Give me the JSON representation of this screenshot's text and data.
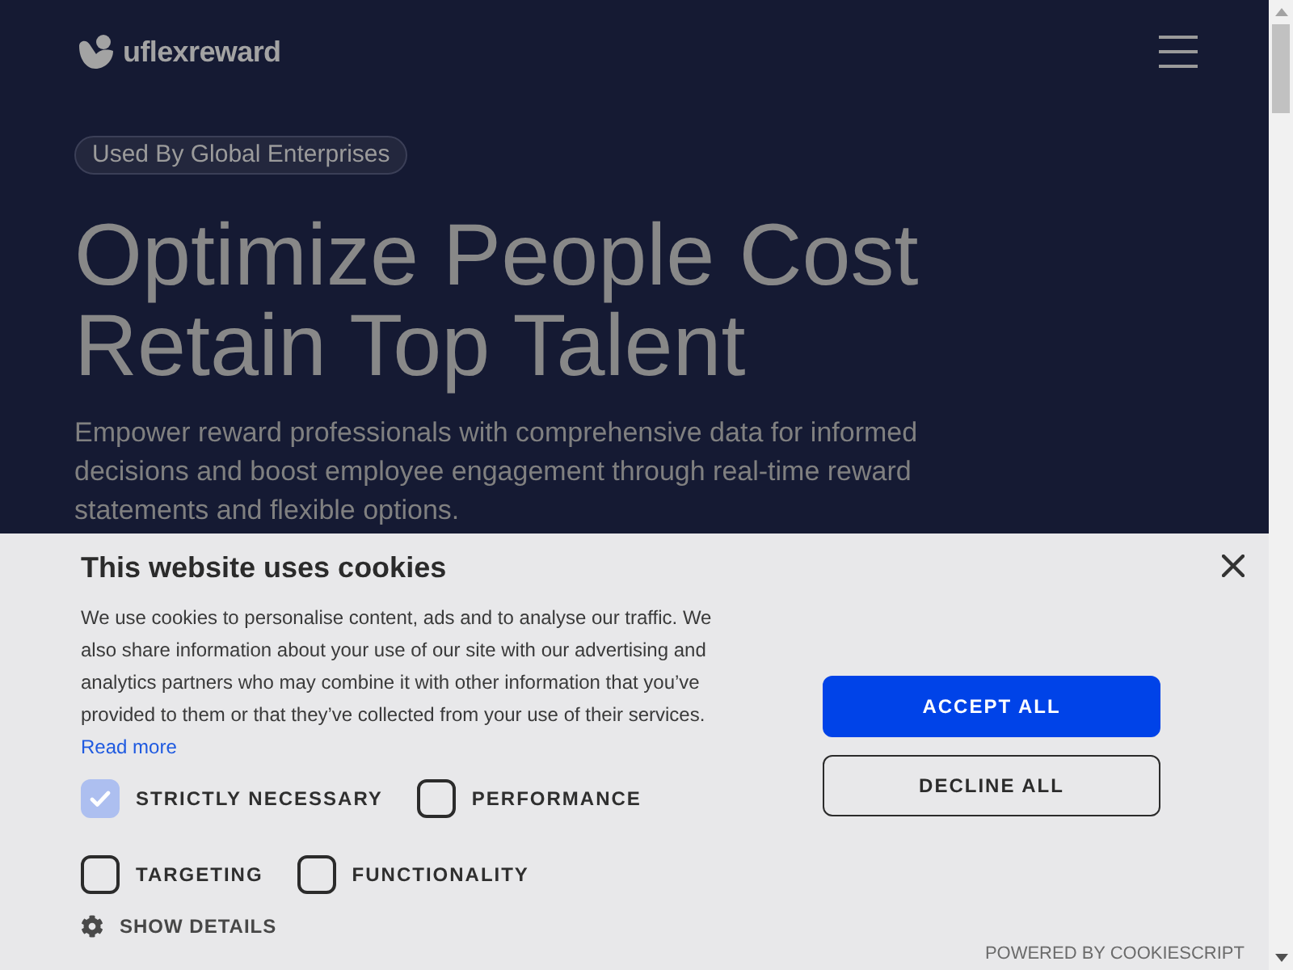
{
  "header": {
    "logo_text": "uflexreward"
  },
  "hero": {
    "badge": "Used By Global Enterprises",
    "title_lines": [
      "Optimize People Cost",
      "Retain Top Talent"
    ],
    "description": "Empower reward professionals with comprehensive data for informed decisions and boost employee engagement through real-time reward statements and flexible options."
  },
  "cookie_banner": {
    "title": "This website uses cookies",
    "description": "We use cookies to personalise content, ads and to analyse our traffic. We also share information about your use of our site with our advertising and analytics partners who may combine it with other information that you’ve provided to them or that they’ve collected from your use of their services.",
    "read_more": "Read more",
    "categories": [
      {
        "label": "STRICTLY NECESSARY",
        "checked": true,
        "disabled": true
      },
      {
        "label": "PERFORMANCE",
        "checked": false,
        "disabled": false
      },
      {
        "label": "TARGETING",
        "checked": false,
        "disabled": false
      },
      {
        "label": "FUNCTIONALITY",
        "checked": false,
        "disabled": false
      }
    ],
    "show_details": "SHOW DETAILS",
    "buttons": [
      {
        "label": "ACCEPT ALL",
        "kind": "primary"
      },
      {
        "label": "DECLINE ALL",
        "kind": "outline"
      }
    ],
    "powered_by": "POWERED BY COOKIESCRIPT"
  }
}
